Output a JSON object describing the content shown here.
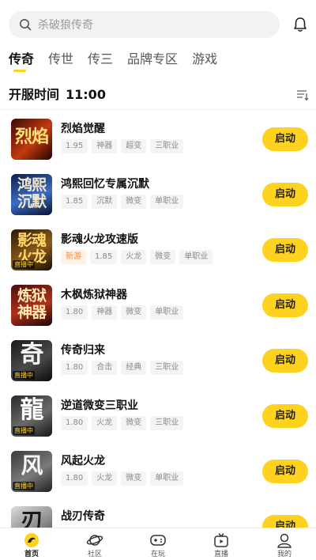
{
  "search": {
    "placeholder": "杀破狼传奇"
  },
  "tabs": [
    {
      "label": "传奇",
      "active": true
    },
    {
      "label": "传世",
      "active": false
    },
    {
      "label": "传三",
      "active": false
    },
    {
      "label": "品牌专区",
      "active": false
    },
    {
      "label": "游戏",
      "active": false
    }
  ],
  "section": {
    "title": "开服时间",
    "time": "11:00"
  },
  "list": [
    {
      "name": "烈焰觉醒",
      "tags": [
        "1.95",
        "神器",
        "超变",
        "三职业"
      ],
      "new_tag": "",
      "button": "启动",
      "thumb_text": "烈焰",
      "live": ""
    },
    {
      "name": "鸿熙回忆专属沉默",
      "tags": [
        "1.85",
        "沉默",
        "微变",
        "单职业"
      ],
      "new_tag": "",
      "button": "启动",
      "thumb_text": "鸿熙沉默",
      "live": ""
    },
    {
      "name": "影魂火龙攻速版",
      "tags": [
        "1.85",
        "火龙",
        "微变",
        "单职业"
      ],
      "new_tag": "新游",
      "button": "启动",
      "thumb_text": "影魂火龙",
      "live": "直播中"
    },
    {
      "name": "木枫炼狱神器",
      "tags": [
        "1.80",
        "神器",
        "微变",
        "单职业"
      ],
      "new_tag": "",
      "button": "启动",
      "thumb_text": "炼狱神器",
      "live": ""
    },
    {
      "name": "传奇归来",
      "tags": [
        "1.80",
        "合击",
        "经典",
        "三职业"
      ],
      "new_tag": "",
      "button": "启动",
      "thumb_text": "奇",
      "live": "直播中"
    },
    {
      "name": "逆道微变三职业",
      "tags": [
        "1.80",
        "火龙",
        "微变",
        "三职业"
      ],
      "new_tag": "",
      "button": "启动",
      "thumb_text": "龍",
      "live": "直播中"
    },
    {
      "name": "风起火龙",
      "tags": [
        "1.80",
        "火龙",
        "微变",
        "单职业"
      ],
      "new_tag": "",
      "button": "启动",
      "thumb_text": "风",
      "live": "直播中"
    },
    {
      "name": "战刃传奇",
      "tags": [],
      "new_tag": "",
      "button": "启动",
      "thumb_text": "刃",
      "live": ""
    }
  ],
  "bottom_nav": [
    {
      "label": "首页",
      "icon": "home-icon",
      "active": true
    },
    {
      "label": "社区",
      "icon": "planet-icon",
      "active": false
    },
    {
      "label": "在玩",
      "icon": "gamepad-icon",
      "active": false
    },
    {
      "label": "直播",
      "icon": "tv-icon",
      "active": false
    },
    {
      "label": "我的",
      "icon": "user-icon",
      "active": false
    }
  ],
  "colors": {
    "accent": "#ffd21f",
    "new_tag": "#ff8a3d"
  }
}
